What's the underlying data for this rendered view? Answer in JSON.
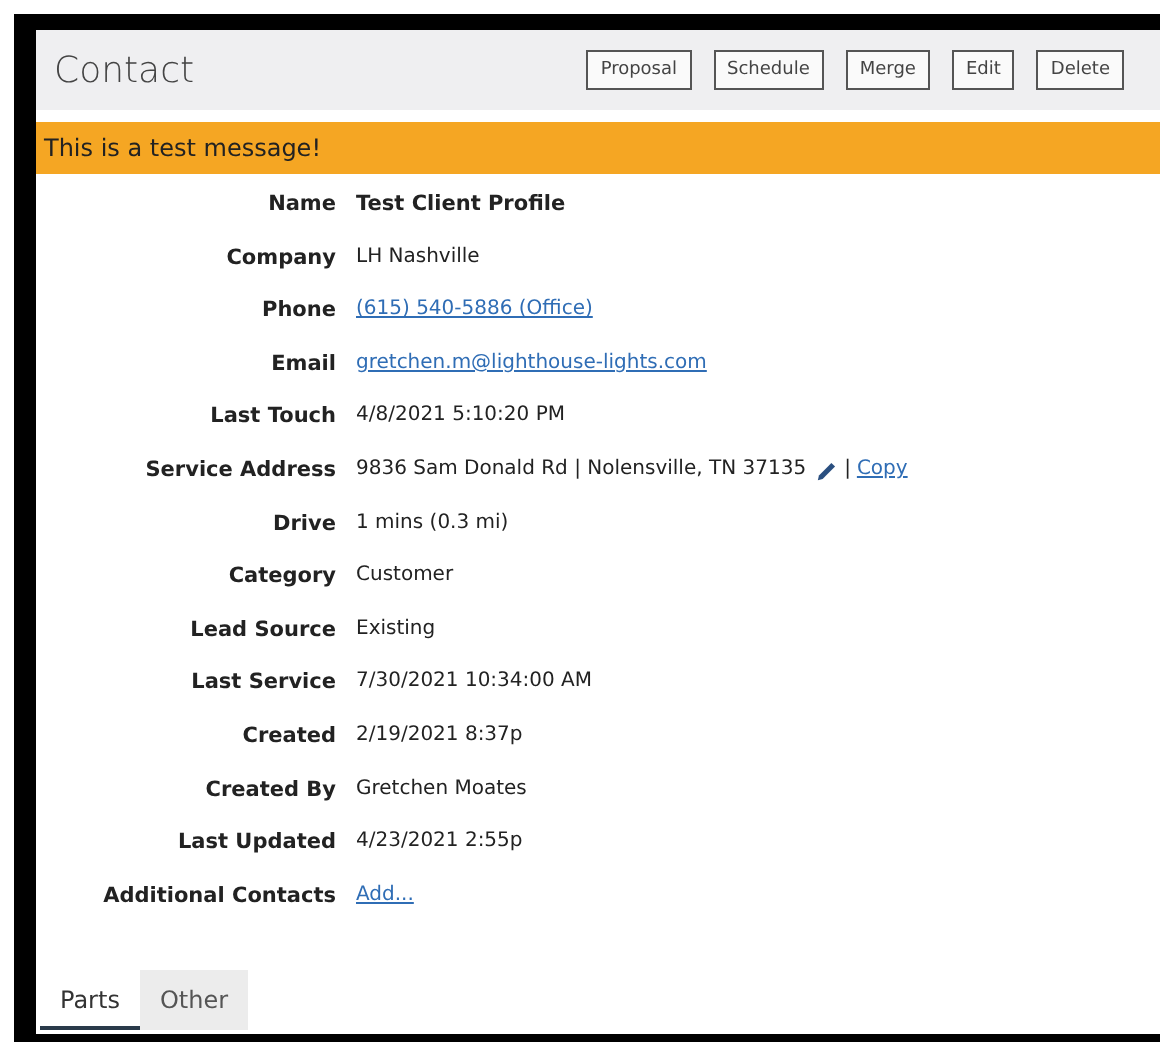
{
  "header": {
    "title": "Contact",
    "buttons": [
      "Proposal",
      "Schedule",
      "Merge",
      "Edit",
      "Delete"
    ]
  },
  "alert": {
    "text": "This is a test message!"
  },
  "fields": [
    {
      "label": "Name",
      "kind": "bold",
      "value": "Test Client Profile"
    },
    {
      "label": "Company",
      "kind": "text",
      "value": "LH Nashville"
    },
    {
      "label": "Phone",
      "kind": "link",
      "value": "(615) 540-5886 (Office)"
    },
    {
      "label": "Email",
      "kind": "link",
      "value": "gretchen.m@lighthouse-lights.com"
    },
    {
      "label": "Last Touch",
      "kind": "text",
      "value": "4/8/2021 5:10:20 PM"
    },
    {
      "label": "Service Address",
      "kind": "address",
      "value": "9836 Sam Donald Rd | Nolensville, TN 37135",
      "separator": "|",
      "action": "Copy"
    },
    {
      "label": "Drive",
      "kind": "text",
      "value": "1 mins (0.3 mi)"
    },
    {
      "label": "Category",
      "kind": "text",
      "value": "Customer"
    },
    {
      "label": "Lead Source",
      "kind": "text",
      "value": "Existing"
    },
    {
      "label": "Last Service",
      "kind": "text",
      "value": "7/30/2021 10:34:00 AM"
    },
    {
      "label": "Created",
      "kind": "text",
      "value": "2/19/2021 8:37p"
    },
    {
      "label": "Created By",
      "kind": "text",
      "value": "Gretchen Moates"
    },
    {
      "label": "Last Updated",
      "kind": "text",
      "value": "4/23/2021 2:55p"
    },
    {
      "label": "Additional Contacts",
      "kind": "link",
      "value": "Add..."
    }
  ],
  "tabs": [
    {
      "label": "Parts",
      "selected": true
    },
    {
      "label": "Other",
      "selected": false
    }
  ]
}
